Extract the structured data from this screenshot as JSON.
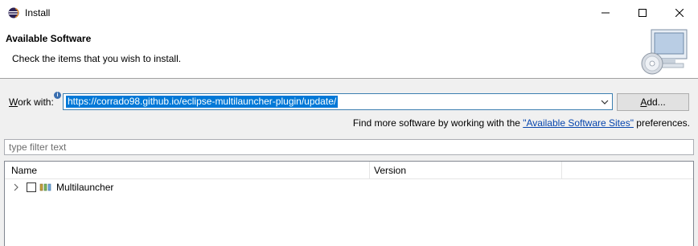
{
  "window": {
    "title": "Install",
    "icon": "eclipse-icon"
  },
  "header": {
    "title": "Available Software",
    "description": "Check the items that you wish to install.",
    "graphic": "computer-cd-icon"
  },
  "work_with": {
    "label_prefix": "W",
    "label_rest": "ork with:",
    "url": "https://corrado98.github.io/eclipse-multilauncher-plugin/update/",
    "add_label_prefix": "A",
    "add_label_rest": "dd..."
  },
  "find_more": {
    "before": "Find more software by working with the ",
    "link": "\"Available Software Sites\"",
    "after": " preferences."
  },
  "filter": {
    "placeholder": "type filter text"
  },
  "tree": {
    "columns": [
      "Name",
      "Version"
    ],
    "items": [
      {
        "label": "Multilauncher",
        "checked": false,
        "expanded": false
      }
    ]
  },
  "colors": {
    "accent": "#0078d7",
    "link": "#0645ad",
    "dialog_bg": "#f0f0f0"
  }
}
